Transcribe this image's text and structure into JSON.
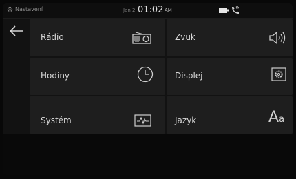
{
  "status": {
    "title": "Nastavení",
    "date": "Jan 2",
    "time": "01:02",
    "ampm": "AM"
  },
  "menu": {
    "radio": "Rádio",
    "sound": "Zvuk",
    "clock": "Hodiny",
    "display": "Displej",
    "system": "Systém",
    "language": "Jazyk",
    "language_icon_big": "A",
    "language_icon_small": "a"
  },
  "icons": {
    "settings": "gear-icon",
    "back": "back-arrow-icon",
    "radio": "radio-icon",
    "sound": "speaker-icon",
    "clock": "clock-icon",
    "display": "display-settings-icon",
    "system": "system-waveform-icon",
    "language": "language-icon",
    "battery": "battery-icon",
    "phone": "phone-bluetooth-icon"
  }
}
